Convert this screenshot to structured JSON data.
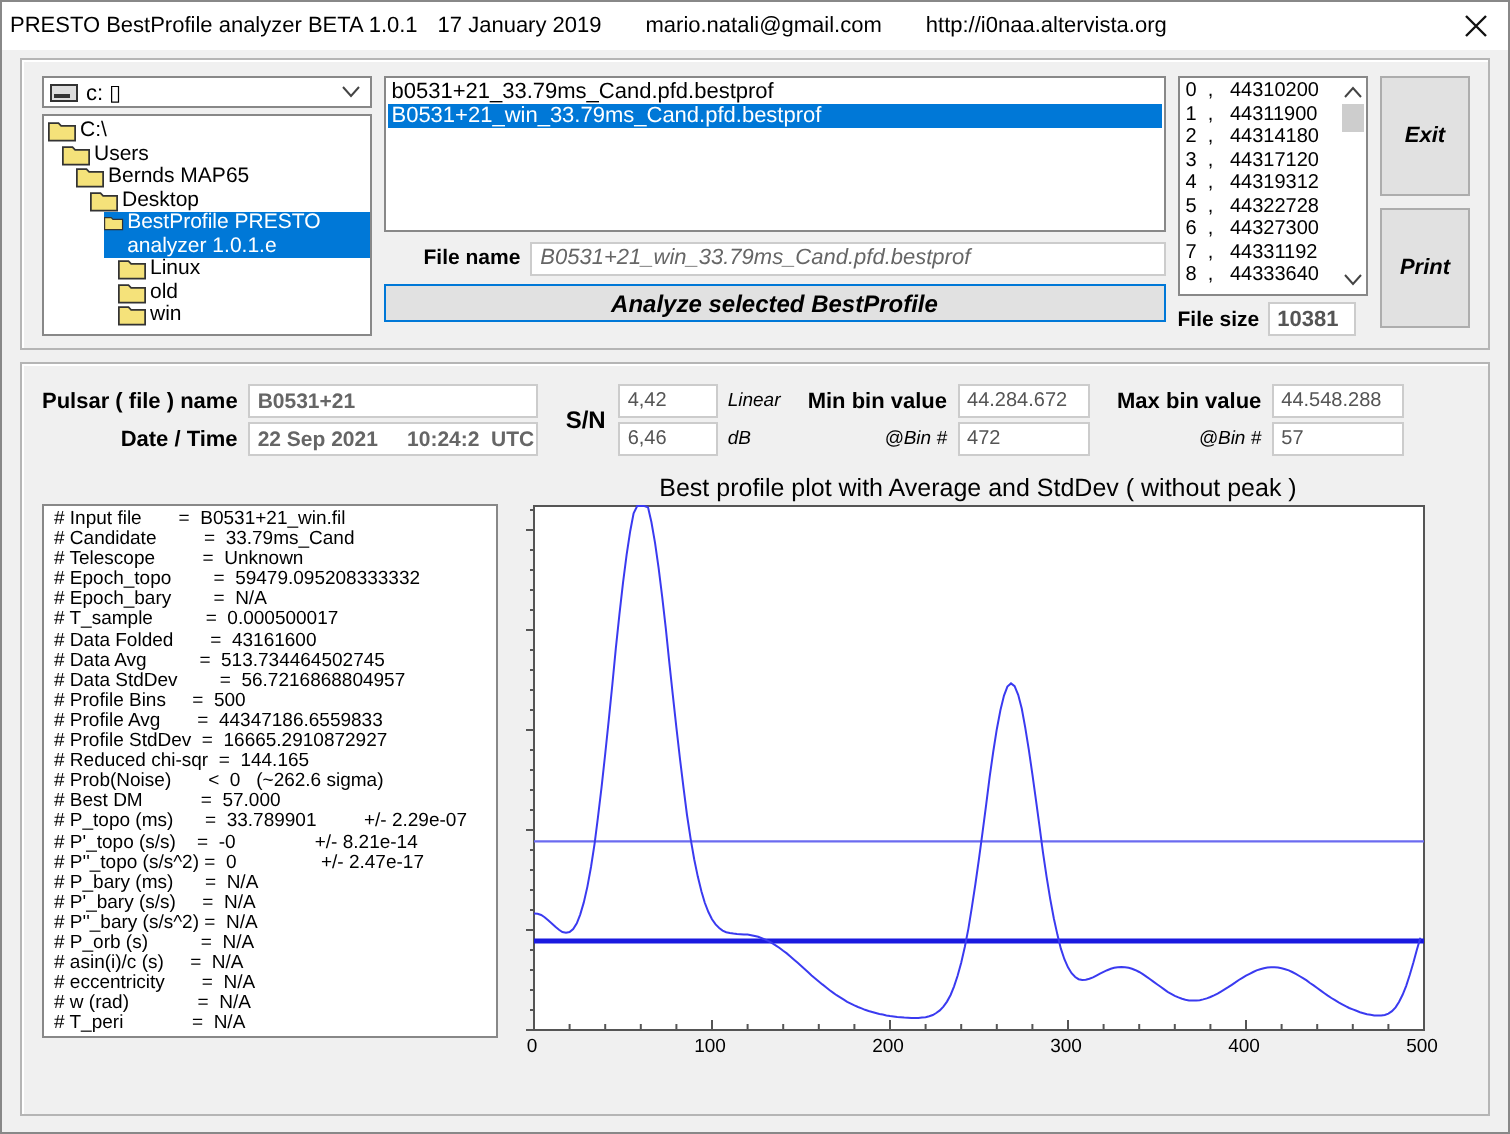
{
  "window": {
    "title": "PRESTO BestProfile analyzer BETA 1.0.1",
    "date": "17 January 2019",
    "email": "mario.natali@gmail.com",
    "url": "http://i0naa.altervista.org"
  },
  "drive": {
    "value": "c: ▯"
  },
  "folders": [
    {
      "label": "C:\\",
      "selected": false,
      "children": [
        {
          "label": "Users",
          "selected": false,
          "children": [
            {
              "label": "Bernds MAP65",
              "selected": false,
              "children": [
                {
                  "label": "Desktop",
                  "selected": false,
                  "children": [
                    {
                      "label": "BestProfile PRESTO analyzer 1.0.1.e",
                      "selected": true,
                      "children": [
                        {
                          "label": "Linux",
                          "selected": false
                        },
                        {
                          "label": "old",
                          "selected": false
                        },
                        {
                          "label": "win",
                          "selected": false
                        }
                      ]
                    }
                  ]
                }
              ]
            }
          ]
        }
      ]
    }
  ],
  "files": [
    {
      "label": "b0531+21_33.79ms_Cand.pfd.bestprof",
      "selected": false
    },
    {
      "label": "B0531+21_win_33.79ms_Cand.pfd.bestprof",
      "selected": true
    }
  ],
  "file_name": {
    "label": "File name",
    "value": "B0531+21_win_33.79ms_Cand.pfd.bestprof"
  },
  "analyze_button": "Analyze selected BestProfile",
  "bins": [
    "0  ,   44310200",
    "1  ,   44311900",
    "2  ,   44314180",
    "3  ,   44317120",
    "4  ,   44319312",
    "5  ,   44322728",
    "6  ,   44327300",
    "7  ,   44331192",
    "8  ,   44333640"
  ],
  "file_size": {
    "label": "File size",
    "value": "10381"
  },
  "buttons": [
    "Exit",
    "Print"
  ],
  "pulsar": {
    "name_label": "Pulsar ( file ) name",
    "name": "B0531+21",
    "date_label": "Date / Time",
    "date": "22 Sep 2021     10:24:2  UTC"
  },
  "sn": {
    "label": "S/N",
    "linear": "4,42",
    "linear_unit": "Linear",
    "db": "6,46",
    "db_unit": "dB"
  },
  "min_bin": {
    "label": "Min bin value",
    "value": "44.284.672",
    "bin_label": "@Bin #",
    "bin": "472"
  },
  "max_bin": {
    "label": "Max bin value",
    "value": "44.548.288",
    "bin_label": "@Bin #",
    "bin": "57"
  },
  "info_lines": [
    "# Input file       =  B0531+21_win.fil",
    "# Candidate         =  33.79ms_Cand",
    "# Telescope         =  Unknown",
    "# Epoch_topo        =  59479.095208333332",
    "# Epoch_bary        =  N/A",
    "# T_sample          =  0.000500017",
    "# Data Folded       =  43161600",
    "# Data Avg          =  513.734464502745",
    "# Data StdDev        =  56.7216868804957",
    "# Profile Bins     =  500",
    "# Profile Avg       =  44347186.6559833",
    "# Profile StdDev  =  16665.2910872927",
    "# Reduced chi-sqr  =  144.165",
    "# Prob(Noise)       <  0   (~262.6 sigma)",
    "# Best DM           =  57.000",
    "# P_topo (ms)      =  33.789901         +/- 2.29e-07",
    "# P'_topo (s/s)    =  -0               +/- 8.21e-14",
    "# P''_topo (s/s^2) =  0                +/- 2.47e-17",
    "# P_bary (ms)      =  N/A",
    "# P'_bary (s/s)     =  N/A",
    "# P''_bary (s/s^2) =  N/A",
    "# P_orb (s)          =  N/A",
    "# asin(i)/c (s)     =  N/A",
    "# eccentricity       =  N/A",
    "# w (rad)             =  N/A",
    "# T_peri             =  N/A"
  ],
  "plot": {
    "title": "Best profile plot with  Average and StdDev ( without peak )",
    "x_tick_labels": [
      "0",
      "100",
      "200",
      "300",
      "400",
      "500"
    ]
  }
}
